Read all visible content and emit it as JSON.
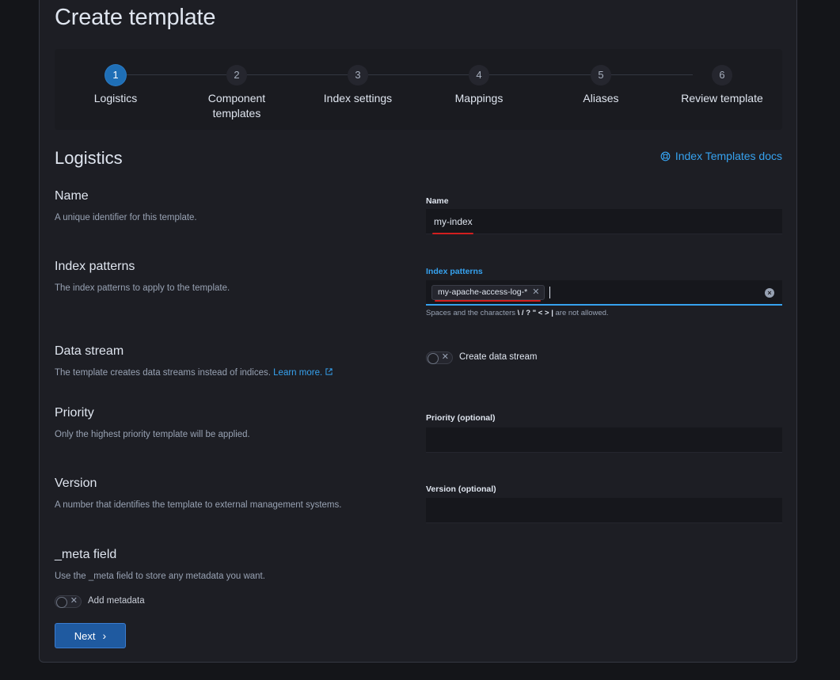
{
  "page": {
    "title": "Create template"
  },
  "steps": [
    {
      "number": "1",
      "label": "Logistics",
      "active": true
    },
    {
      "number": "2",
      "label": "Component templates",
      "active": false
    },
    {
      "number": "3",
      "label": "Index settings",
      "active": false
    },
    {
      "number": "4",
      "label": "Mappings",
      "active": false
    },
    {
      "number": "5",
      "label": "Aliases",
      "active": false
    },
    {
      "number": "6",
      "label": "Review template",
      "active": false
    }
  ],
  "section": {
    "title": "Logistics",
    "docs_link": "Index Templates docs"
  },
  "fields": {
    "name": {
      "title": "Name",
      "description": "A unique identifier for this template.",
      "label": "Name",
      "value": "my-index"
    },
    "index_patterns": {
      "title": "Index patterns",
      "description": "The index patterns to apply to the template.",
      "label": "Index patterns",
      "pill": "my-apache-access-log-*",
      "help_prefix": "Spaces and the characters",
      "help_chars": "\\ / ? \" < >",
      "help_pipe": "|",
      "help_suffix": "are not allowed."
    },
    "data_stream": {
      "title": "Data stream",
      "description": "The template creates data streams instead of indices.",
      "learn_more": "Learn more.",
      "toggle_label": "Create data stream"
    },
    "priority": {
      "title": "Priority",
      "description": "Only the highest priority template will be applied.",
      "label": "Priority (optional)",
      "value": ""
    },
    "version": {
      "title": "Version",
      "description": "A number that identifies the template to external management systems.",
      "label": "Version (optional)",
      "value": ""
    },
    "meta": {
      "title": "_meta field",
      "description": "Use the _meta field to store any metadata you want.",
      "toggle_label": "Add metadata"
    }
  },
  "actions": {
    "next": "Next"
  },
  "colors": {
    "accent": "#36a2ef",
    "primary_button": "#1f5aa0",
    "annotation": "#d21f1f"
  }
}
